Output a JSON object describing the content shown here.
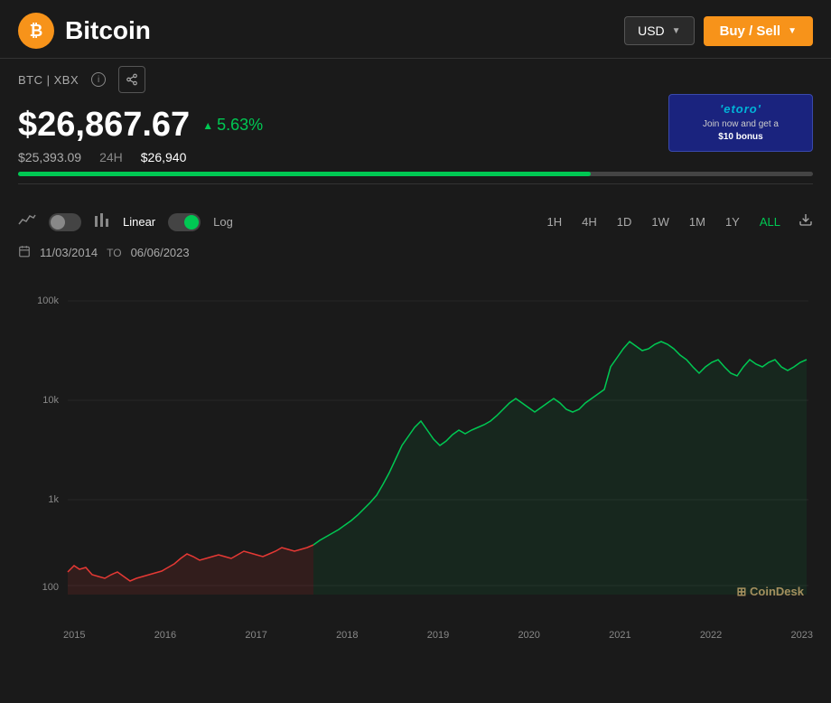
{
  "header": {
    "coin_name": "Bitcoin",
    "coin_symbol": "₿",
    "ticker": "BTC | XBX",
    "currency": "USD",
    "buy_sell_label": "Buy / Sell"
  },
  "price": {
    "value": "$26,867.67",
    "change_pct": "5.63%",
    "low": "$25,393.09",
    "period": "24H",
    "high": "$26,940",
    "progress_width": "72%"
  },
  "ad": {
    "brand": "'etoro'",
    "tagline": "Join now and get a",
    "bonus": "$10 bonus"
  },
  "chart_controls": {
    "scale_linear": "Linear",
    "scale_log": "Log",
    "time_buttons": [
      "1H",
      "4H",
      "1D",
      "1W",
      "1M",
      "1Y",
      "ALL"
    ]
  },
  "date_range": {
    "from": "11/03/2014",
    "to_label": "TO",
    "to": "06/06/2023"
  },
  "y_axis": {
    "labels": [
      "100k",
      "10k",
      "1k",
      "100"
    ]
  },
  "x_axis": {
    "labels": [
      "2015",
      "2016",
      "2017",
      "2018",
      "2019",
      "2020",
      "2021",
      "2022",
      "2023"
    ]
  },
  "watermark": "⊞ CoinDesk"
}
